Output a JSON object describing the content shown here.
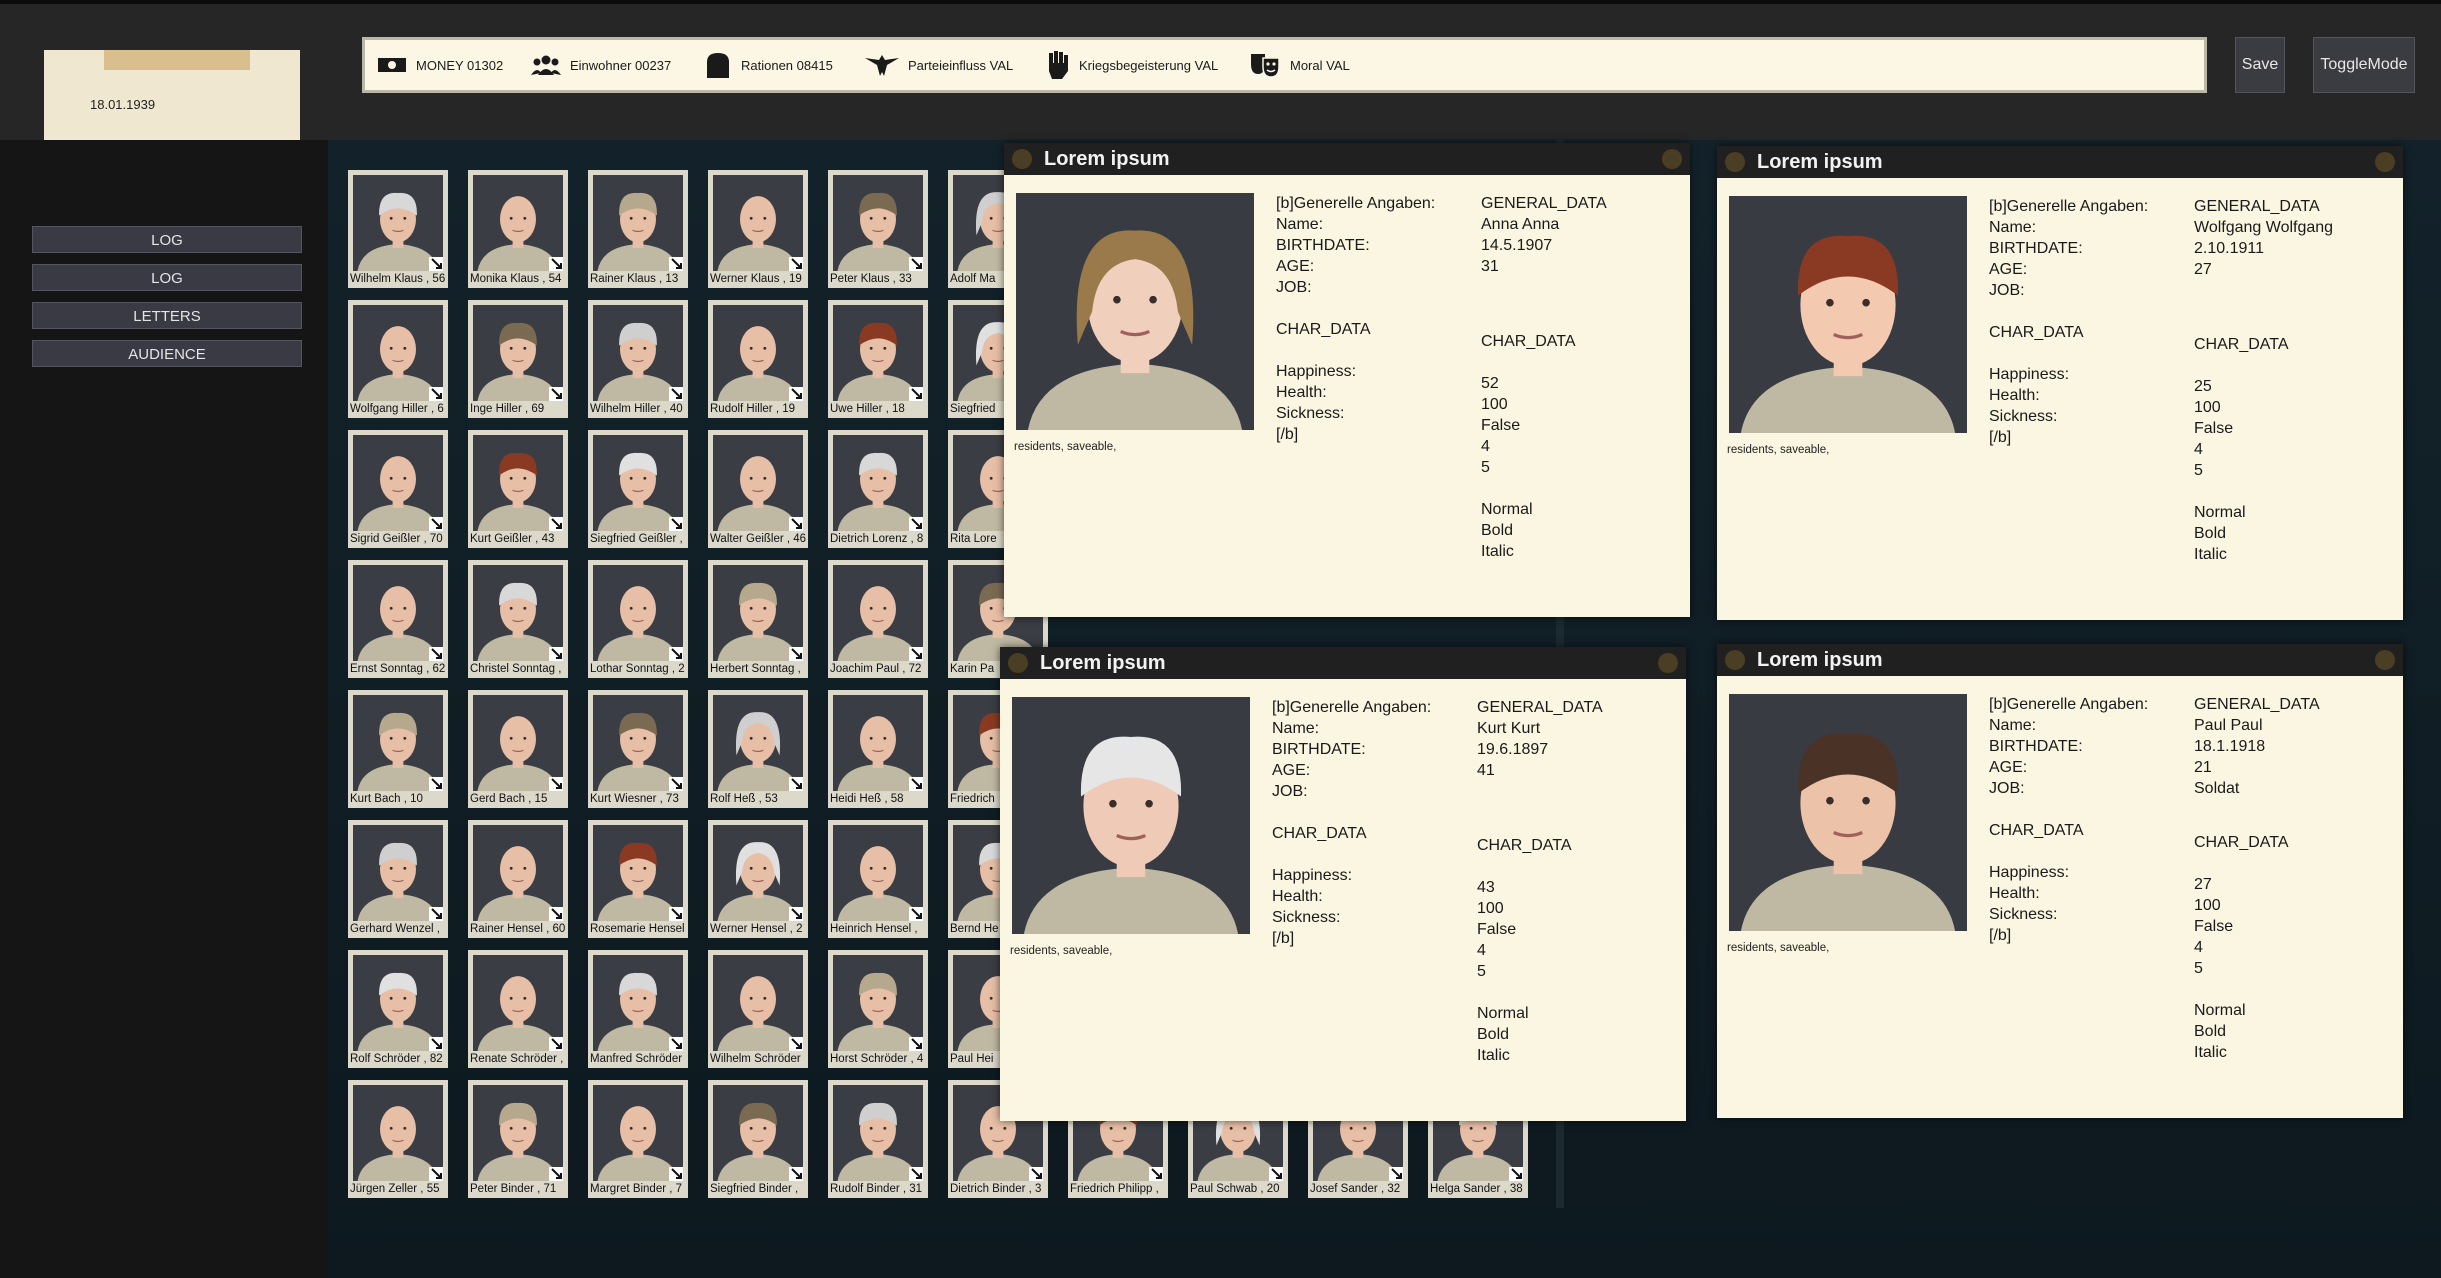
{
  "date": "18.01.1939",
  "sidebar": {
    "buttons": [
      "LOG",
      "LOG",
      "LETTERS",
      "AUDIENCE"
    ]
  },
  "resources": [
    {
      "label": "MONEY 01302",
      "icon": "money-icon"
    },
    {
      "label": "Einwohner 00237",
      "icon": "people-icon"
    },
    {
      "label": "Rationen 08415",
      "icon": "bread-icon"
    },
    {
      "label": "Parteieinfluss VAL",
      "icon": "eagle-icon"
    },
    {
      "label": "Kriegsbegeisterung VAL",
      "icon": "fist-icon"
    },
    {
      "label": "Moral VAL",
      "icon": "masks-icon"
    }
  ],
  "top_buttons": {
    "save": "Save",
    "toggle": "ToggleMode"
  },
  "residents": [
    [
      "Wilhelm Klaus , 56",
      "Monika Klaus , 54",
      "Rainer Klaus , 13",
      "Werner Klaus , 19",
      "Peter Klaus , 33",
      "Adolf Ma"
    ],
    [
      "Wolfgang Hiller , 6",
      "Inge Hiller , 69",
      "Wilhelm Hiller , 40",
      "Rudolf Hiller , 19",
      "Uwe Hiller , 18",
      "Siegfried"
    ],
    [
      "Sigrid Geißler , 70",
      "Kurt Geißler , 43",
      "Siegfried Geißler , ",
      "Walter Geißler , 46",
      "Dietrich Lorenz , 8",
      "Rita Lore"
    ],
    [
      "Ernst Sonntag , 62",
      "Christel Sonntag , ",
      "Lothar Sonntag , 2",
      "Herbert Sonntag , ",
      "Joachim Paul , 72",
      "Karin Pa"
    ],
    [
      "Kurt Bach , 10",
      "Gerd Bach , 15",
      "Kurt Wiesner , 73",
      "Rolf Heß , 53",
      "Heidi Heß , 58",
      "Friedrich"
    ],
    [
      "Gerhard Wenzel , ",
      "Rainer Hensel , 60",
      "Rosemarie Hensel",
      "Werner Hensel , 2",
      "Heinrich Hensel , ",
      "Bernd He"
    ],
    [
      "Rolf Schröder , 82",
      "Renate Schröder , ",
      "Manfred Schröder",
      "Wilhelm Schröder",
      "Horst Schröder , 4",
      "Paul Hei"
    ],
    [
      "Jürgen Zeller , 55",
      "Peter Binder , 71",
      "Margret Binder , 7",
      "Siegfried Binder , ",
      "Rudolf Binder , 31",
      "Dietrich Binder , 3",
      "Friedrich Philipp , ",
      "Paul Schwab , 20",
      "Josef Sander , 32",
      "Helga Sander , 38"
    ]
  ],
  "panel_labels": {
    "title": "Lorem ipsum",
    "general": "[b]Generelle Angaben:",
    "name": "Name:",
    "birth": "BIRTHDATE:",
    "age": "AGE:",
    "job": "JOB:",
    "char": "CHAR_DATA",
    "happiness": "Happiness:",
    "health": "Health:",
    "sickness": "Sickness:",
    "end": "[/b]",
    "caption": "residents, saveable,",
    "general_data": "GENERAL_DATA",
    "normal": "Normal",
    "bold": "Bold",
    "italic": "Italic"
  },
  "panels": [
    {
      "name": "Anna Anna",
      "birthdate": "14.5.1907",
      "age": "31",
      "job": "",
      "happiness": "52",
      "health": "100",
      "sickness": "False",
      "v4": "4",
      "v5": "5"
    },
    {
      "name": "Wolfgang Wolfgang",
      "birthdate": "2.10.1911",
      "age": "27",
      "job": "",
      "happiness": "25",
      "health": "100",
      "sickness": "False",
      "v4": "4",
      "v5": "5"
    },
    {
      "name": "Kurt Kurt",
      "birthdate": "19.6.1897",
      "age": "41",
      "job": "",
      "happiness": "43",
      "health": "100",
      "sickness": "False",
      "v4": "4",
      "v5": "5"
    },
    {
      "name": "Paul Paul",
      "birthdate": "18.1.1918",
      "age": "21",
      "job": "Soldat",
      "happiness": "27",
      "health": "100",
      "sickness": "False",
      "v4": "4",
      "v5": "5"
    }
  ]
}
